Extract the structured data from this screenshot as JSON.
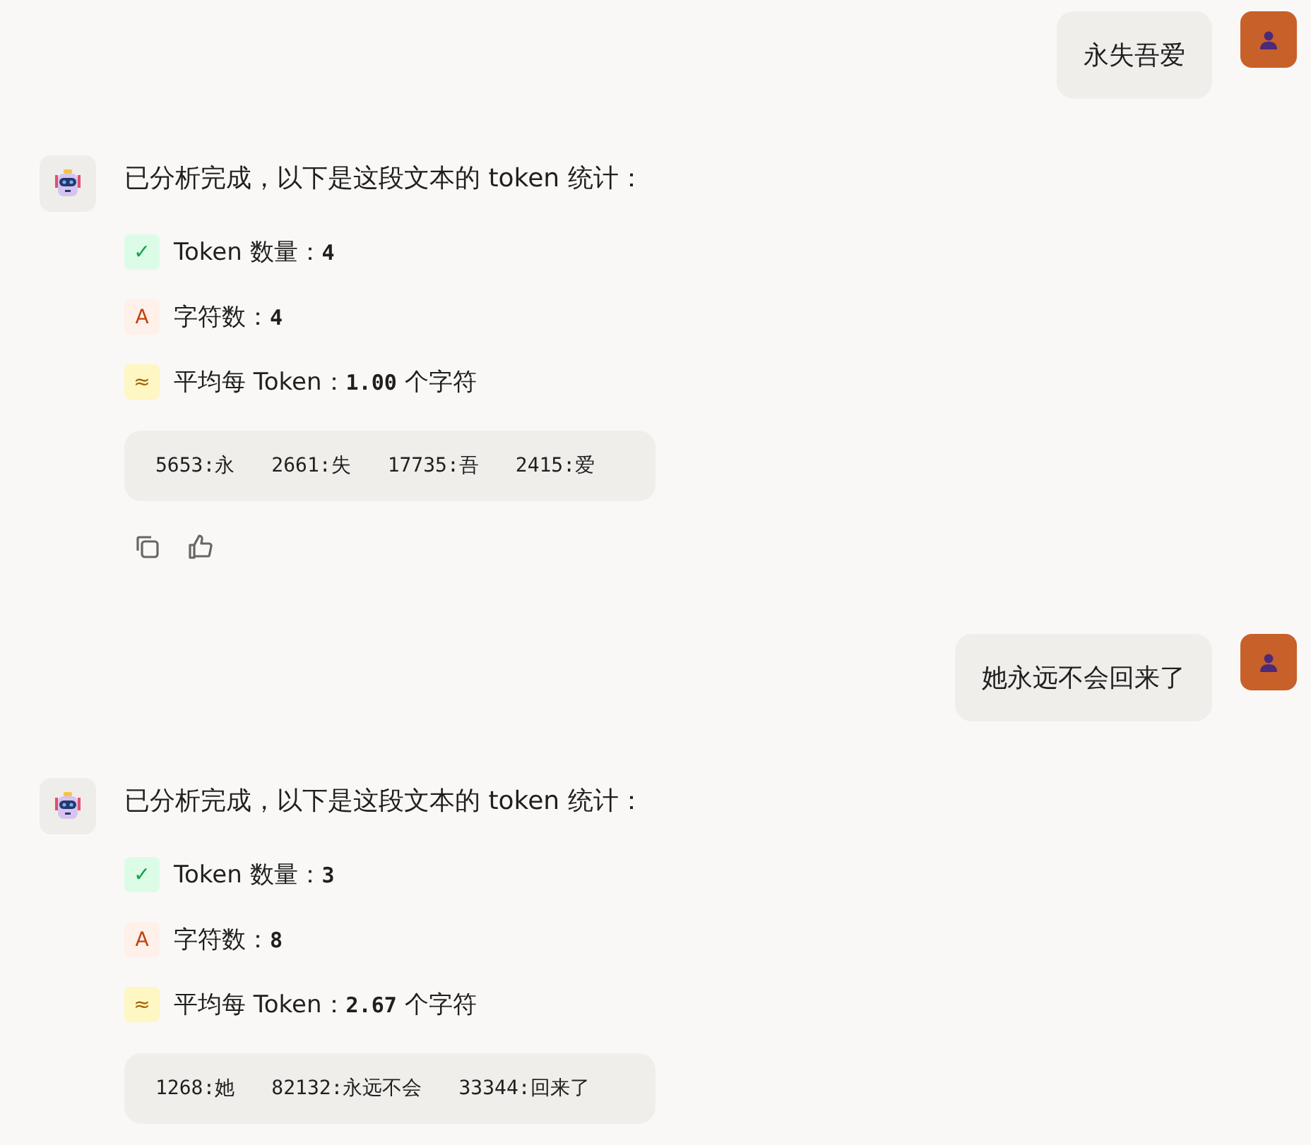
{
  "messages": [
    {
      "kind": "user",
      "text": "永失吾爱"
    },
    {
      "kind": "bot",
      "intro": "已分析完成，以下是这段文本的 token 统计：",
      "stats": [
        {
          "kind": "check",
          "icon": "✓",
          "label": "Token 数量：",
          "value": "4"
        },
        {
          "kind": "letter",
          "icon": "A",
          "label": "字符数：",
          "value": "4"
        },
        {
          "kind": "approx",
          "icon": "≈",
          "label": "平均每 Token：",
          "value": "1.00",
          "suffix": "个字符"
        }
      ],
      "tokens": [
        "5653:永",
        "2661:失",
        "17735:吾",
        "2415:爱"
      ],
      "actions": true
    },
    {
      "kind": "user",
      "text": "她永远不会回来了"
    },
    {
      "kind": "bot",
      "intro": "已分析完成，以下是这段文本的 token 统计：",
      "stats": [
        {
          "kind": "check",
          "icon": "✓",
          "label": "Token 数量：",
          "value": "3"
        },
        {
          "kind": "letter",
          "icon": "A",
          "label": "字符数：",
          "value": "8"
        },
        {
          "kind": "approx",
          "icon": "≈",
          "label": "平均每 Token：",
          "value": "2.67",
          "suffix": "个字符"
        }
      ],
      "tokens": [
        "1268:她",
        "82132:永远不会",
        "33344:回来了"
      ],
      "actions": false
    }
  ]
}
